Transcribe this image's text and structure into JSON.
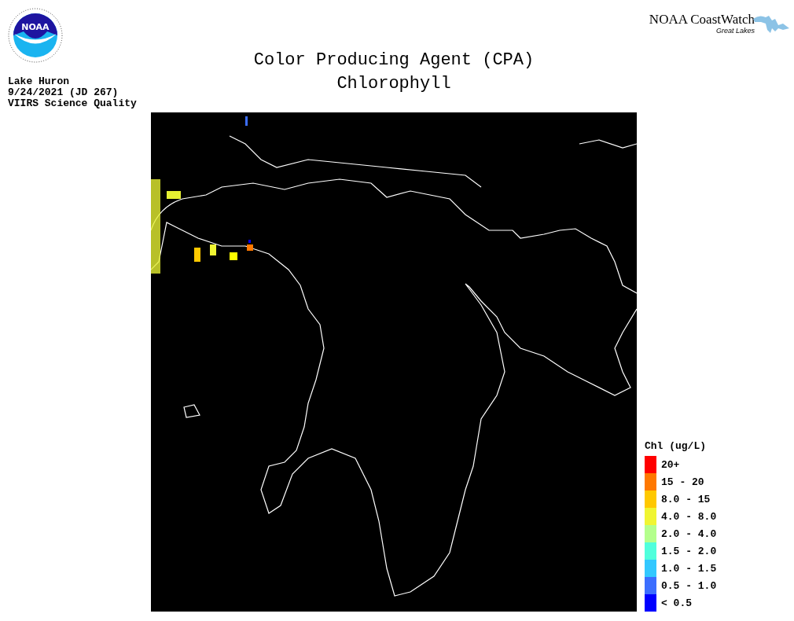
{
  "logo": {
    "text": "NOAA"
  },
  "title": [
    "Color Producing Agent (CPA)",
    "Chlorophyll"
  ],
  "brand": {
    "name": "NOAA CoastWatch",
    "subtitle": "Great Lakes"
  },
  "info": [
    "Lake Huron",
    "9/24/2021 (JD 267)",
    "VIIRS Science Quality"
  ],
  "legend": {
    "title": "Chl (ug/L)",
    "items": [
      {
        "label": "20+",
        "color": "#ff0000"
      },
      {
        "label": "15 - 20",
        "color": "#ff7800"
      },
      {
        "label": "8.0 - 15",
        "color": "#ffc800"
      },
      {
        "label": "4.0 - 8.0",
        "color": "#f0f532"
      },
      {
        "label": "2.0 - 4.0",
        "color": "#b4ff8c"
      },
      {
        "label": "1.5 - 2.0",
        "color": "#50ffdc"
      },
      {
        "label": "1.0 - 1.5",
        "color": "#32c8ff"
      },
      {
        "label": "0.5 - 1.0",
        "color": "#3c6eff"
      },
      {
        "label": "< 0.5",
        "color": "#0000ff"
      }
    ]
  }
}
